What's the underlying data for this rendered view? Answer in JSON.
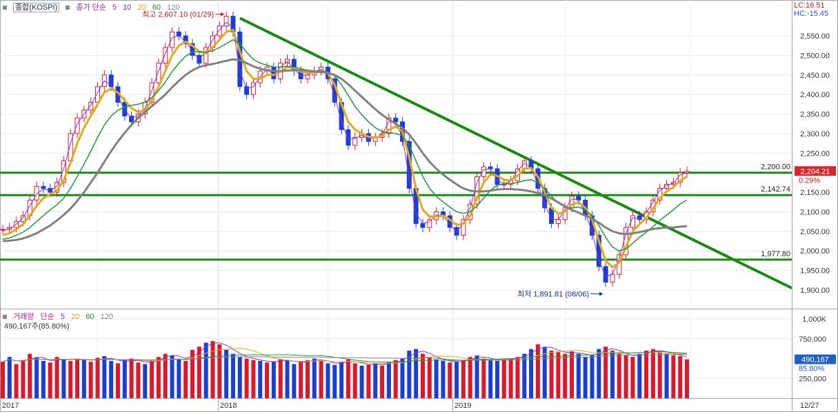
{
  "main_legend": {
    "title": "종합(KOSPI)",
    "ma_label": "종가 단순",
    "ma_periods": [
      "5",
      "10",
      "20",
      "60",
      "120"
    ],
    "ma_colors": [
      "#8a2be2",
      "#3d3dc8",
      "#d4a017",
      "#1a8a3a",
      "#808080"
    ]
  },
  "lc_hc": {
    "lc": "LC:16.51",
    "hc": "HC:-15.45"
  },
  "annotations": {
    "high": "최고 2,607.10 (01/29)",
    "low": "최저 1,891.81 (08/06)"
  },
  "price_axis": {
    "ticks": [
      "2,550.00",
      "2,500.00",
      "2,450.00",
      "2,400.00",
      "2,350.00",
      "2,300.00",
      "2,250.00",
      "2,200.00",
      "2,150.00",
      "2,100.00",
      "2,050.00",
      "2,000.00",
      "1,950.00",
      "1,900.00"
    ],
    "tick_values": [
      2550,
      2500,
      2450,
      2400,
      2350,
      2300,
      2250,
      2200,
      2150,
      2100,
      2050,
      2000,
      1950,
      1900
    ],
    "current_price": "2,204.21",
    "change_pct": "0.29%"
  },
  "hlines": [
    {
      "value": 2200.0,
      "label": "2,200.00"
    },
    {
      "value": 2142.74,
      "label": "2,142.74"
    },
    {
      "value": 1977.8,
      "label": "1,977.80"
    }
  ],
  "volume_legend": {
    "title": "거래량",
    "ma_label": "단순",
    "ma_periods": [
      "5",
      "20",
      "60",
      "120"
    ],
    "ma_colors": [
      "#8a2be2",
      "#d4a017",
      "#1a8a3a",
      "#808080"
    ],
    "info": "490,167주(85.80%)"
  },
  "volume_axis": {
    "ticks": [
      "1,000K",
      "750,000",
      "250,000"
    ],
    "tick_values": [
      1000000,
      750000,
      250000
    ],
    "current": "490,167",
    "pct": "85.80%"
  },
  "x_axis": {
    "labels": [
      "2017",
      "2018",
      "2019"
    ],
    "right_label": "12/27"
  },
  "colors": {
    "up": "#e0162b",
    "down": "#1a3fd6",
    "trend": "#1a8a10",
    "ma5": "#8a2be2",
    "ma20": "#e6a817",
    "ma60": "#1a9a3a",
    "ma120": "#808080",
    "badge": "#d9262b",
    "vol_badge": "#2060c0"
  },
  "chart_data": {
    "type": "line",
    "y_range": [
      1880,
      2620
    ],
    "volume_range": [
      0,
      1050000
    ],
    "series": [
      {
        "name": "종합(KOSPI)",
        "values": [
          2055,
          2060,
          2075,
          2090,
          2130,
          2165,
          2160,
          2150,
          2175,
          2230,
          2300,
          2340,
          2360,
          2380,
          2420,
          2450,
          2420,
          2380,
          2345,
          2330,
          2350,
          2380,
          2430,
          2480,
          2520,
          2560,
          2550,
          2530,
          2500,
          2480,
          2520,
          2550,
          2575,
          2600,
          2560,
          2420,
          2400,
          2430,
          2460,
          2470,
          2440,
          2480,
          2490,
          2460,
          2440,
          2450,
          2460,
          2470,
          2440,
          2380,
          2310,
          2270,
          2290,
          2300,
          2280,
          2290,
          2300,
          2340,
          2330,
          2280,
          2160,
          2070,
          2060,
          2080,
          2100,
          2090,
          2060,
          2040,
          2080,
          2120,
          2190,
          2215,
          2210,
          2170,
          2170,
          2180,
          2210,
          2230,
          2210,
          2160,
          2110,
          2070,
          2080,
          2110,
          2140,
          2130,
          2090,
          2040,
          1960,
          1920,
          1940,
          1990,
          2060,
          2090,
          2080,
          2100,
          2130,
          2160,
          2170,
          2175,
          2200,
          2204
        ]
      },
      {
        "name": "5",
        "values": [
          2050,
          2057,
          2068,
          2085,
          2115,
          2145,
          2158,
          2155,
          2165,
          2210,
          2275,
          2325,
          2350,
          2372,
          2405,
          2435,
          2425,
          2395,
          2360,
          2340,
          2345,
          2365,
          2410,
          2460,
          2505,
          2545,
          2550,
          2535,
          2510,
          2490,
          2510,
          2540,
          2565,
          2585,
          2570,
          2460,
          2415,
          2420,
          2445,
          2465,
          2450,
          2470,
          2485,
          2465,
          2448,
          2450,
          2458,
          2465,
          2448,
          2395,
          2330,
          2285,
          2288,
          2296,
          2286,
          2290,
          2298,
          2330,
          2330,
          2290,
          2185,
          2095,
          2070,
          2075,
          2092,
          2090,
          2068,
          2048,
          2072,
          2110,
          2175,
          2208,
          2210,
          2180,
          2172,
          2178,
          2205,
          2225,
          2212,
          2170,
          2120,
          2080,
          2080,
          2105,
          2133,
          2130,
          2095,
          2050,
          1975,
          1935,
          1940,
          1980,
          2045,
          2085,
          2082,
          2098,
          2125,
          2155,
          2167,
          2173,
          2195,
          2200
        ]
      },
      {
        "name": "20",
        "values": [
          2040,
          2045,
          2055,
          2068,
          2090,
          2115,
          2135,
          2145,
          2155,
          2180,
          2225,
          2275,
          2315,
          2345,
          2375,
          2405,
          2415,
          2405,
          2385,
          2365,
          2355,
          2360,
          2385,
          2420,
          2460,
          2500,
          2525,
          2535,
          2525,
          2510,
          2505,
          2520,
          2540,
          2560,
          2565,
          2510,
          2460,
          2440,
          2440,
          2450,
          2450,
          2458,
          2470,
          2468,
          2458,
          2455,
          2456,
          2460,
          2455,
          2425,
          2375,
          2330,
          2310,
          2300,
          2292,
          2290,
          2294,
          2310,
          2318,
          2305,
          2240,
          2160,
          2105,
          2088,
          2088,
          2090,
          2080,
          2066,
          2070,
          2090,
          2135,
          2175,
          2195,
          2192,
          2182,
          2180,
          2192,
          2210,
          2212,
          2190,
          2150,
          2110,
          2095,
          2100,
          2118,
          2125,
          2110,
          2080,
          2025,
          1975,
          1958,
          1970,
          2010,
          2050,
          2068,
          2085,
          2108,
          2135,
          2152,
          2163,
          2180,
          2190
        ]
      },
      {
        "name": "60",
        "values": [
          2030,
          2033,
          2040,
          2048,
          2060,
          2075,
          2090,
          2105,
          2118,
          2135,
          2160,
          2190,
          2222,
          2255,
          2290,
          2322,
          2345,
          2360,
          2368,
          2372,
          2375,
          2380,
          2392,
          2410,
          2432,
          2458,
          2480,
          2498,
          2508,
          2510,
          2508,
          2512,
          2520,
          2530,
          2540,
          2530,
          2508,
          2490,
          2480,
          2475,
          2470,
          2470,
          2472,
          2470,
          2466,
          2462,
          2460,
          2460,
          2458,
          2448,
          2425,
          2398,
          2370,
          2348,
          2330,
          2315,
          2305,
          2302,
          2300,
          2295,
          2270,
          2230,
          2190,
          2160,
          2140,
          2125,
          2112,
          2100,
          2096,
          2100,
          2115,
          2135,
          2155,
          2168,
          2172,
          2172,
          2175,
          2180,
          2182,
          2175,
          2160,
          2140,
          2122,
          2112,
          2110,
          2112,
          2105,
          2090,
          2065,
          2035,
          2010,
          2000,
          2005,
          2020,
          2035,
          2048,
          2062,
          2078,
          2092,
          2105,
          2120,
          2130
        ]
      },
      {
        "name": "120",
        "values": [
          2025,
          2026,
          2028,
          2032,
          2038,
          2045,
          2055,
          2065,
          2078,
          2092,
          2108,
          2128,
          2150,
          2175,
          2200,
          2228,
          2255,
          2280,
          2302,
          2322,
          2340,
          2355,
          2370,
          2385,
          2400,
          2418,
          2435,
          2450,
          2462,
          2470,
          2475,
          2478,
          2482,
          2486,
          2490,
          2488,
          2480,
          2472,
          2466,
          2462,
          2460,
          2460,
          2461,
          2462,
          2462,
          2461,
          2459,
          2457,
          2455,
          2450,
          2440,
          2426,
          2410,
          2394,
          2378,
          2362,
          2348,
          2336,
          2325,
          2314,
          2298,
          2275,
          2250,
          2228,
          2210,
          2195,
          2182,
          2170,
          2160,
          2154,
          2152,
          2152,
          2154,
          2157,
          2158,
          2158,
          2157,
          2155,
          2152,
          2148,
          2142,
          2134,
          2124,
          2114,
          2105,
          2098,
          2090,
          2082,
          2072,
          2060,
          2050,
          2045,
          2043,
          2045,
          2048,
          2052,
          2056,
          2058,
          2060,
          2060,
          2062,
          2063
        ]
      }
    ],
    "trendline": {
      "start_value": 2595,
      "end_value": 1905
    },
    "volume": {
      "name": "거래량",
      "values": [
        460000,
        520000,
        430000,
        480000,
        560000,
        510000,
        470000,
        450000,
        520000,
        490000,
        470000,
        500000,
        480000,
        460000,
        510000,
        530000,
        470000,
        440000,
        480000,
        500000,
        450000,
        430000,
        470000,
        520000,
        560000,
        540000,
        500000,
        470000,
        610000,
        650000,
        700000,
        720000,
        680000,
        610000,
        560000,
        520000,
        500000,
        480000,
        470000,
        450000,
        460000,
        490000,
        480000,
        430000,
        460000,
        480000,
        500000,
        470000,
        440000,
        420000,
        460000,
        490000,
        440000,
        410000,
        420000,
        440000,
        410000,
        460000,
        480000,
        500000,
        600000,
        620000,
        560000,
        520000,
        490000,
        470000,
        450000,
        460000,
        480000,
        520000,
        540000,
        500000,
        480000,
        470000,
        490000,
        500000,
        520000,
        560000,
        620000,
        680000,
        640000,
        600000,
        580000,
        560000,
        590000,
        560000,
        520000,
        540000,
        620000,
        650000,
        600000,
        560000,
        540000,
        520000,
        560000,
        600000,
        620000,
        580000,
        560000,
        540000,
        530000,
        490167
      ],
      "up": [
        1,
        0,
        1,
        1,
        1,
        0,
        0,
        1,
        1,
        0,
        1,
        1,
        0,
        1,
        1,
        0,
        0,
        1,
        0,
        1,
        1,
        0,
        1,
        1,
        1,
        0,
        0,
        1,
        1,
        1,
        0,
        1,
        1,
        0,
        0,
        0,
        1,
        1,
        0,
        1,
        0,
        1,
        0,
        0,
        1,
        1,
        0,
        1,
        0,
        0,
        0,
        1,
        1,
        0,
        1,
        0,
        1,
        0,
        1,
        0,
        0,
        0,
        1,
        1,
        0,
        0,
        1,
        0,
        1,
        1,
        0,
        1,
        0,
        0,
        1,
        1,
        1,
        0,
        0,
        1,
        0,
        1,
        1,
        1,
        1,
        0,
        0,
        0,
        0,
        1,
        0,
        1,
        1,
        1,
        0,
        1,
        1,
        1,
        0,
        1,
        1,
        1
      ]
    }
  }
}
